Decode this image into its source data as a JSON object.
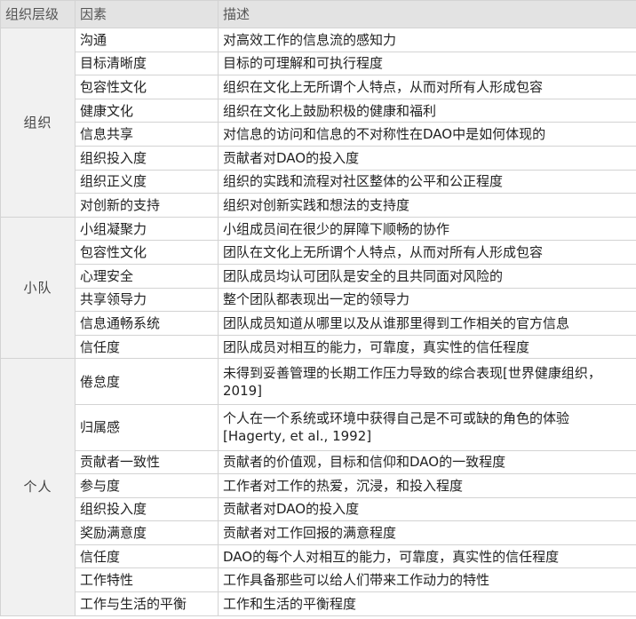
{
  "headers": {
    "level": "组织层级",
    "factor": "因素",
    "desc": "描述"
  },
  "groups": [
    {
      "level": "组织",
      "rows": [
        {
          "factor": "沟通",
          "desc": "对高效工作的信息流的感知力"
        },
        {
          "factor": "目标清晰度",
          "desc": "目标的可理解和可执行程度"
        },
        {
          "factor": "包容性文化",
          "desc": "组织在文化上无所谓个人特点，从而对所有人形成包容"
        },
        {
          "factor": "健康文化",
          "desc": "组织在文化上鼓励积极的健康和福利"
        },
        {
          "factor": "信息共享",
          "desc": "对信息的访问和信息的不对称性在DAO中是如何体现的"
        },
        {
          "factor": "组织投入度",
          "desc": "贡献者对DAO的投入度"
        },
        {
          "factor": "组织正义度",
          "desc": "组织的实践和流程对社区整体的公平和公正程度"
        },
        {
          "factor": "对创新的支持",
          "desc": "组织对创新实践和想法的支持度"
        }
      ]
    },
    {
      "level": "小队",
      "rows": [
        {
          "factor": "小组凝聚力",
          "desc": "小组成员间在很少的屏障下顺畅的协作"
        },
        {
          "factor": "包容性文化",
          "desc": "团队在文化上无所谓个人特点，从而对所有人形成包容"
        },
        {
          "factor": "心理安全",
          "desc": "团队成员均认可团队是安全的且共同面对风险的"
        },
        {
          "factor": "共享领导力",
          "desc": "整个团队都表现出一定的领导力"
        },
        {
          "factor": "信息通畅系统",
          "desc": "团队成员知道从哪里以及从谁那里得到工作相关的官方信息"
        },
        {
          "factor": "信任度",
          "desc": "团队成员对相互的能力，可靠度，真实性的信任程度"
        }
      ]
    },
    {
      "level": "个人",
      "rows": [
        {
          "factor": "倦怠度",
          "desc": "未得到妥善管理的长期工作压力导致的综合表现[世界健康组织，2019]"
        },
        {
          "factor": "归属感",
          "desc": "个人在一个系统或环境中获得自己是不可或缺的角色的体验[Hagerty, et al., 1992]"
        },
        {
          "factor": "贡献者一致性",
          "desc": "贡献者的价值观，目标和信仰和DAO的一致程度"
        },
        {
          "factor": "参与度",
          "desc": "工作者对工作的热爱，沉浸，和投入程度"
        },
        {
          "factor": "组织投入度",
          "desc": "贡献者对DAO的投入度"
        },
        {
          "factor": "奖励满意度",
          "desc": "贡献者对工作回报的满意程度"
        },
        {
          "factor": "信任度",
          "desc": "DAO的每个人对相互的能力，可靠度，真实性的信任程度"
        },
        {
          "factor": "工作特性",
          "desc": "工作具备那些可以给人们带来工作动力的特性"
        },
        {
          "factor": "工作与生活的平衡",
          "desc": "工作和生活的平衡程度"
        }
      ]
    }
  ]
}
